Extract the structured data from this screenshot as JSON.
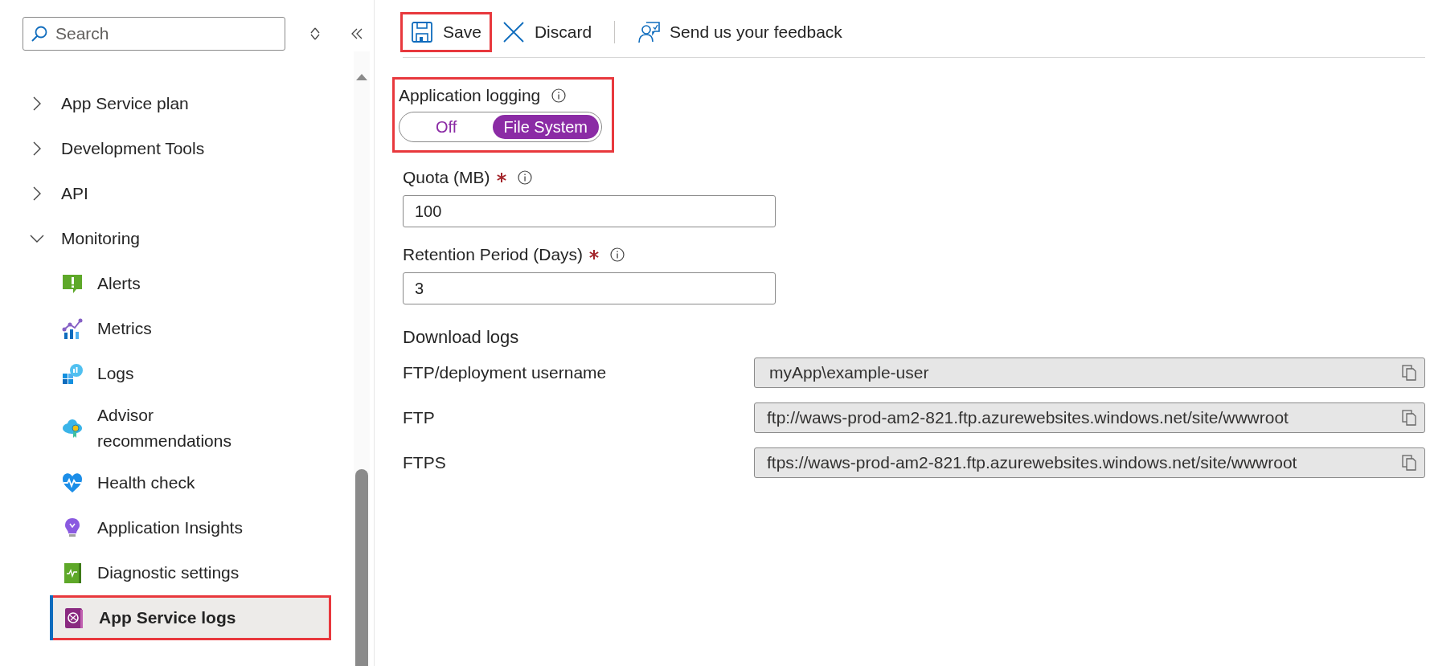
{
  "sidebar": {
    "search": {
      "placeholder": "Search"
    },
    "items": [
      {
        "label": "App Service plan",
        "expanded": false
      },
      {
        "label": "Development Tools",
        "expanded": false
      },
      {
        "label": "API",
        "expanded": false
      },
      {
        "label": "Monitoring",
        "expanded": true,
        "children": [
          {
            "label": "Alerts",
            "selected": false,
            "highlighted": false
          },
          {
            "label": "Metrics",
            "selected": false,
            "highlighted": false
          },
          {
            "label": "Logs",
            "selected": false,
            "highlighted": false
          },
          {
            "label": "Advisor recommendations",
            "selected": false,
            "highlighted": false
          },
          {
            "label": "Health check",
            "selected": false,
            "highlighted": false
          },
          {
            "label": "Application Insights",
            "selected": false,
            "highlighted": false
          },
          {
            "label": "Diagnostic settings",
            "selected": false,
            "highlighted": false
          },
          {
            "label": "App Service logs",
            "selected": true,
            "highlighted": true
          }
        ]
      }
    ]
  },
  "toolbar": [
    {
      "kind": "save",
      "label": "Save",
      "highlighted": true
    },
    {
      "kind": "discard",
      "label": "Discard",
      "highlighted": false
    },
    {
      "kind": "feedback",
      "label": "Send us your feedback",
      "highlighted": false
    }
  ],
  "application_logging": {
    "label": "Application logging",
    "highlighted": true,
    "options": [
      {
        "label": "Off",
        "selected": false
      },
      {
        "label": "File System",
        "selected": true
      }
    ]
  },
  "fields": [
    {
      "label": "Quota (MB)",
      "required": true,
      "value": "100"
    },
    {
      "label": "Retention Period (Days)",
      "required": true,
      "value": "3"
    }
  ],
  "download_logs": {
    "title": "Download logs",
    "rows": [
      {
        "label": "FTP/deployment username",
        "value": "myApp\\example-user"
      },
      {
        "label": "FTP",
        "value": "ftp://waws-prod-am2-821.ftp.azurewebsites.windows.net/site/wwwroot"
      },
      {
        "label": "FTPS",
        "value": "ftps://waws-prod-am2-821.ftp.azurewebsites.windows.net/site/wwwroot"
      }
    ]
  }
}
